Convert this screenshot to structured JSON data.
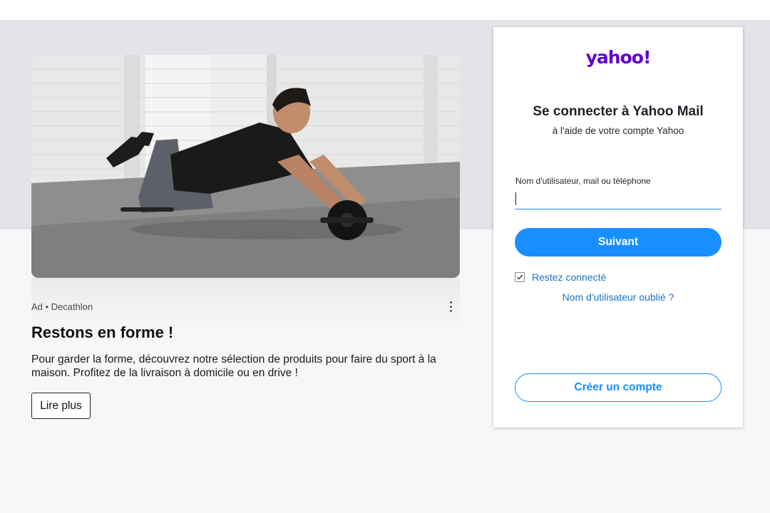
{
  "ad": {
    "meta": "Ad • Decathlon",
    "title": "Restons en forme !",
    "description": "Pour garder la forme, découvrez notre sélection de produits pour faire du sport à la maison. Profitez de la livraison à domicile ou en drive !",
    "cta_label": "Lire plus"
  },
  "login": {
    "logo_text": "yahoo!",
    "title": "Se connecter à Yahoo Mail",
    "subtitle": "à l'aide de votre compte Yahoo",
    "username_label": "Nom d'utilisateur, mail ou téléphone",
    "username_value": "",
    "next_label": "Suivant",
    "stay_connected_label": "Restez connecté",
    "stay_connected_checked": true,
    "forgot_label": "Nom d'utilisateur oublié ?",
    "create_account_label": "Créer un compte"
  },
  "colors": {
    "brand_purple": "#6001d2",
    "accent_blue": "#188fff",
    "link_blue": "#1a73c4",
    "top_band": "#e2e4e9",
    "bottom_band": "#f6f7f9"
  },
  "icons": {
    "ad_menu": "more-vertical-icon",
    "checkbox": "checkmark-icon"
  }
}
